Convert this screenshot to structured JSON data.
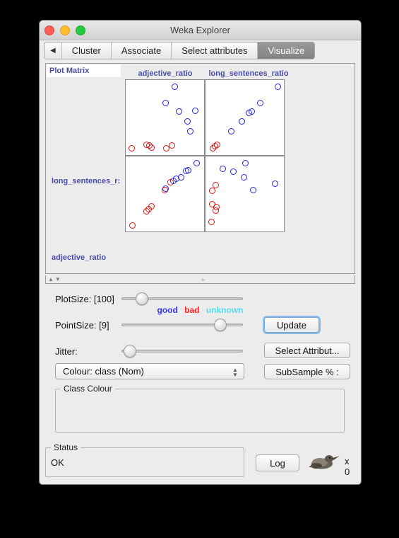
{
  "window": {
    "title": "Weka Explorer",
    "traffic_lights": [
      "close-button",
      "minimize-button",
      "zoom-button"
    ]
  },
  "tabs": {
    "scroll_left_label": "◀",
    "items": [
      {
        "label": "Cluster",
        "selected": false
      },
      {
        "label": "Associate",
        "selected": false
      },
      {
        "label": "Select attributes",
        "selected": false
      },
      {
        "label": "Visualize",
        "selected": true
      }
    ]
  },
  "plot_matrix": {
    "corner_label": "Plot Matrix",
    "column_headers": [
      "adjective_ratio",
      "long_sentences_ratio"
    ],
    "row_labels": [
      "long_sentences_r:",
      "adjective_ratio"
    ]
  },
  "controls": {
    "plotsize": {
      "label": "PlotSize: [100]",
      "value": 100,
      "knob_pct": 13
    },
    "pointsize": {
      "label": "PointSize: [9]",
      "value": 9,
      "knob_pct": 85
    },
    "jitter": {
      "label": "Jitter:",
      "value": 0,
      "knob_pct": 2
    },
    "update_button": "Update",
    "select_attributes_button": "Select Attribut...",
    "subsample_button": "SubSample % :",
    "colour_combo": "Colour: class (Nom)"
  },
  "class_colour": {
    "title": "Class Colour",
    "classes": [
      {
        "label": "good",
        "color": "#3333ff"
      },
      {
        "label": "bad",
        "color": "#ff2222"
      },
      {
        "label": "unknown",
        "color": "#55ddee"
      }
    ]
  },
  "status": {
    "title": "Status",
    "text": "OK",
    "log_button": "Log",
    "bird_count": "x 0"
  },
  "chart_data": {
    "type": "scatter",
    "title": "Plot Matrix",
    "variables": [
      "adjective_ratio",
      "long_sentences_ratio"
    ],
    "class_field": "class",
    "classes": [
      "good",
      "bad",
      "unknown"
    ],
    "class_colors": {
      "good": "#2222dd",
      "bad": "#dd1111",
      "unknown": "#55ddee"
    },
    "panels": [
      {
        "row": "long_sentences_ratio",
        "col": "adjective_ratio",
        "points": [
          {
            "x": 0.64,
            "y": 0.97,
            "c": "good"
          },
          {
            "x": 0.5,
            "y": 0.72,
            "c": "good"
          },
          {
            "x": 0.7,
            "y": 0.6,
            "c": "good"
          },
          {
            "x": 0.93,
            "y": 0.61,
            "c": "good"
          },
          {
            "x": 0.82,
            "y": 0.45,
            "c": "good"
          },
          {
            "x": 0.86,
            "y": 0.3,
            "c": "good"
          },
          {
            "x": 0.02,
            "y": 0.04,
            "c": "bad"
          },
          {
            "x": 0.23,
            "y": 0.1,
            "c": "bad"
          },
          {
            "x": 0.27,
            "y": 0.09,
            "c": "bad"
          },
          {
            "x": 0.3,
            "y": 0.05,
            "c": "bad"
          },
          {
            "x": 0.52,
            "y": 0.04,
            "c": "bad"
          },
          {
            "x": 0.6,
            "y": 0.09,
            "c": "bad"
          }
        ]
      },
      {
        "row": "long_sentences_ratio",
        "col": "long_sentences_ratio",
        "points": [
          {
            "x": 0.97,
            "y": 0.97,
            "c": "good"
          },
          {
            "x": 0.72,
            "y": 0.72,
            "c": "good"
          },
          {
            "x": 0.6,
            "y": 0.6,
            "c": "good"
          },
          {
            "x": 0.56,
            "y": 0.57,
            "c": "good"
          },
          {
            "x": 0.45,
            "y": 0.45,
            "c": "good"
          },
          {
            "x": 0.3,
            "y": 0.3,
            "c": "good"
          },
          {
            "x": 0.1,
            "y": 0.1,
            "c": "bad"
          },
          {
            "x": 0.07,
            "y": 0.07,
            "c": "bad"
          },
          {
            "x": 0.04,
            "y": 0.04,
            "c": "bad"
          }
        ]
      },
      {
        "row": "adjective_ratio",
        "col": "adjective_ratio",
        "points": [
          {
            "x": 0.95,
            "y": 0.97,
            "c": "good"
          },
          {
            "x": 0.83,
            "y": 0.86,
            "c": "good"
          },
          {
            "x": 0.8,
            "y": 0.85,
            "c": "good"
          },
          {
            "x": 0.73,
            "y": 0.76,
            "c": "good"
          },
          {
            "x": 0.66,
            "y": 0.73,
            "c": "good"
          },
          {
            "x": 0.62,
            "y": 0.7,
            "c": "good"
          },
          {
            "x": 0.58,
            "y": 0.68,
            "c": "bad"
          },
          {
            "x": 0.5,
            "y": 0.58,
            "c": "good"
          },
          {
            "x": 0.49,
            "y": 0.56,
            "c": "bad"
          },
          {
            "x": 0.3,
            "y": 0.32,
            "c": "bad"
          },
          {
            "x": 0.26,
            "y": 0.28,
            "c": "bad"
          },
          {
            "x": 0.23,
            "y": 0.25,
            "c": "bad"
          },
          {
            "x": 0.03,
            "y": 0.03,
            "c": "bad"
          }
        ]
      },
      {
        "row": "adjective_ratio",
        "col": "long_sentences_ratio",
        "points": [
          {
            "x": 0.5,
            "y": 0.97,
            "c": "good"
          },
          {
            "x": 0.18,
            "y": 0.88,
            "c": "good"
          },
          {
            "x": 0.33,
            "y": 0.84,
            "c": "good"
          },
          {
            "x": 0.48,
            "y": 0.76,
            "c": "good"
          },
          {
            "x": 0.93,
            "y": 0.66,
            "c": "good"
          },
          {
            "x": 0.62,
            "y": 0.56,
            "c": "good"
          },
          {
            "x": 0.08,
            "y": 0.64,
            "c": "bad"
          },
          {
            "x": 0.03,
            "y": 0.55,
            "c": "bad"
          },
          {
            "x": 0.03,
            "y": 0.35,
            "c": "bad"
          },
          {
            "x": 0.09,
            "y": 0.31,
            "c": "bad"
          },
          {
            "x": 0.08,
            "y": 0.26,
            "c": "bad"
          },
          {
            "x": 0.02,
            "y": 0.09,
            "c": "bad"
          }
        ]
      }
    ]
  }
}
